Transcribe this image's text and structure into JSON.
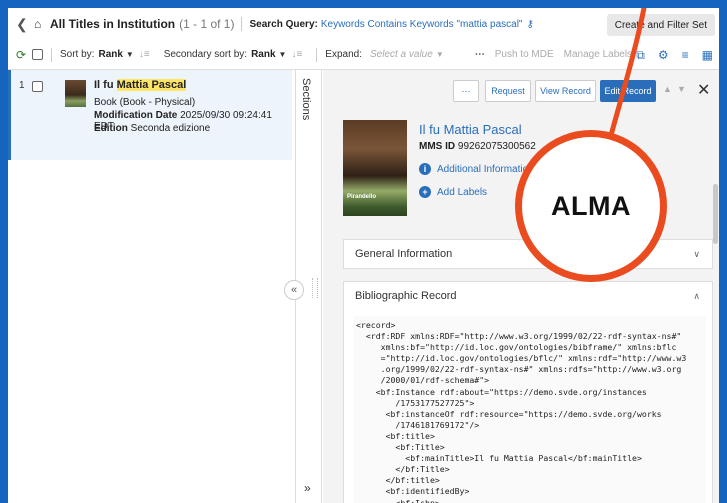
{
  "header": {
    "title": "All Titles in Institution",
    "count": "(1 - 1 of 1)",
    "search_label": "Search Query:",
    "search_value": "Keywords Contains Keywords \"mattia pascal\"",
    "create_button": "Create and Filter Set"
  },
  "toolbar": {
    "sort_label": "Sort by:",
    "sort_value": "Rank",
    "secondary_label": "Secondary sort by:",
    "secondary_value": "Rank",
    "expand_label": "Expand:",
    "expand_placeholder": "Select a value",
    "push_label": "Push to MDE",
    "manage_label": "Manage Labels"
  },
  "result": {
    "number": "1",
    "title_highlight": "Mattia Pascal",
    "title_prefix": "Il fu ",
    "type": "Book (Book - Physical)",
    "mod_label": "Modification Date",
    "mod_value": "2025/09/30 09:24:41 EDT",
    "edition_label": "Edition",
    "edition_value": "Seconda edizione"
  },
  "sections_label": "Sections",
  "record": {
    "request": "Request",
    "view": "View Record",
    "edit": "Edit Record",
    "title": "Il fu Mattia Pascal",
    "mms_label": "MMS ID",
    "mms_value": "99262075300562",
    "additional_info": "Additional Information",
    "add_labels": "Add Labels",
    "cover_text": "Pirandello",
    "general_info": "General Information",
    "bib_record": "Bibliographic Record"
  },
  "xml_lines": [
    "<record>",
    "  <rdf:RDF xmlns:RDF=\"http://www.w3.org/1999/02/22-rdf-syntax-ns#\"",
    "     xmlns:bf=\"http://id.loc.gov/ontologies/bibframe/\" xmlns:bflc",
    "     =\"http://id.loc.gov/ontologies/bflc/\" xmlns:rdf=\"http://www.w3",
    "     .org/1999/02/22-rdf-syntax-ns#\" xmlns:rdfs=\"http://www.w3.org",
    "     /2000/01/rdf-schema#\">",
    "    <bf:Instance rdf:about=\"https://demo.svde.org/instances",
    "        /1753177527725\">",
    "      <bf:instanceOf rdf:resource=\"https://demo.svde.org/works",
    "        /1746181769172\"/>",
    "      <bf:title>",
    "        <bf:Title>",
    "          <bf:mainTitle>Il fu Mattia Pascal</bf:mainTitle>",
    "        </bf:Title>",
    "      </bf:title>",
    "      <bf:identifiedBy>",
    "        <bf:Isbn>"
  ],
  "logo_text": "ALMA"
}
